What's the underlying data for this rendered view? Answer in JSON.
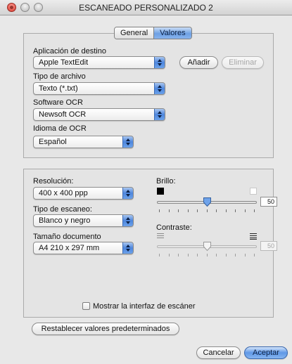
{
  "window": {
    "title": "ESCANEADO PERSONALIZADO 2"
  },
  "tabs": [
    {
      "label": "General",
      "active": false
    },
    {
      "label": "Valores",
      "active": true
    }
  ],
  "destination": {
    "label": "Aplicación de destino",
    "selected": "Apple TextEdit",
    "add_button": "Añadir",
    "remove_button": "Eliminar"
  },
  "file_type": {
    "label": "Tipo de archivo",
    "selected": "Texto (*.txt)"
  },
  "ocr_software": {
    "label": "Software OCR",
    "selected": "Newsoft OCR"
  },
  "ocr_language": {
    "label": "Idioma de OCR",
    "selected": "Español"
  },
  "resolution": {
    "label": "Resolución:",
    "selected": "400 x 400 ppp"
  },
  "scan_type": {
    "label": "Tipo de escaneo:",
    "selected": "Blanco y negro"
  },
  "document_size": {
    "label": "Tamaño documento",
    "selected": "A4  210 x 297 mm"
  },
  "brightness": {
    "label": "Brillo:",
    "value": "50",
    "fraction": 0.5,
    "enabled": true
  },
  "contrast": {
    "label": "Contraste:",
    "value": "50",
    "fraction": 0.5,
    "enabled": false
  },
  "show_scanner_interface": {
    "label": "Mostrar la interfaz de escáner",
    "checked": false
  },
  "buttons": {
    "reset": "Restablecer valores predeterminados",
    "cancel": "Cancelar",
    "accept": "Aceptar"
  },
  "colors": {
    "accent": "#5f98e6",
    "close": "#d6362b"
  }
}
